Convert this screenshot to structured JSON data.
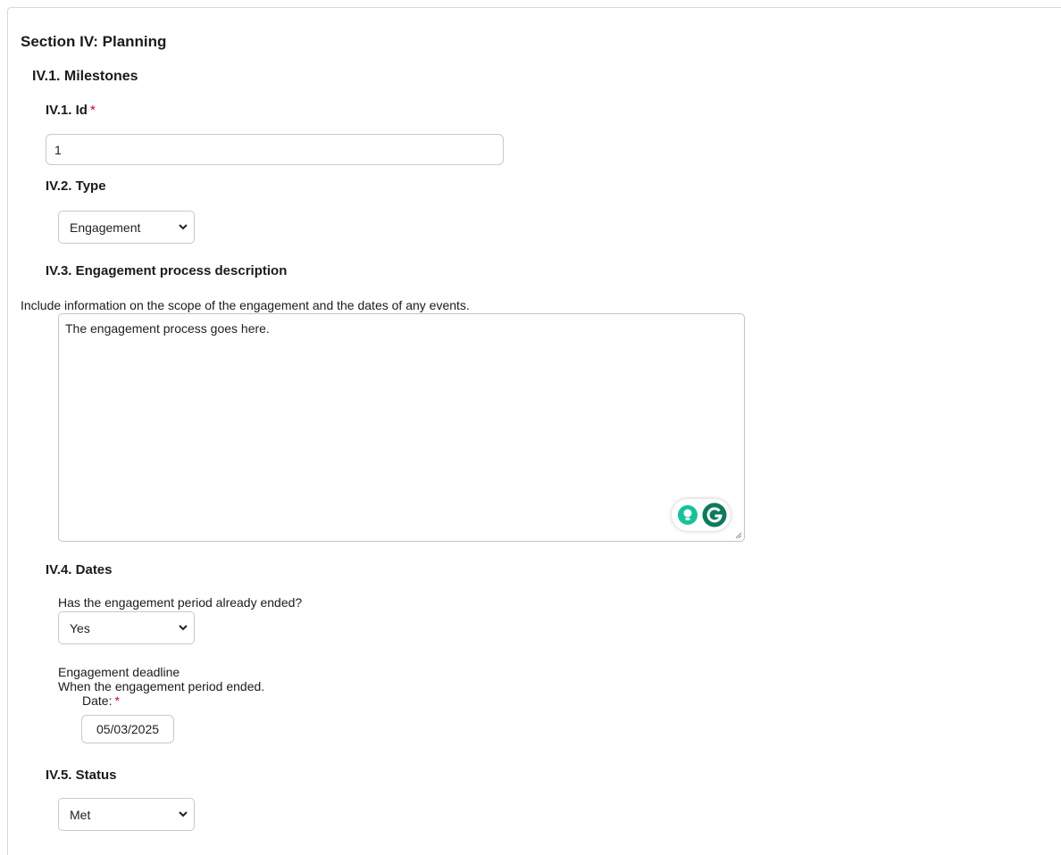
{
  "section": {
    "title": "Section IV: Planning",
    "subsection_title": "IV.1. Milestones"
  },
  "fields": {
    "id": {
      "label": "IV.1. Id",
      "required_marker": "*",
      "value": "1"
    },
    "type": {
      "label": "IV.2. Type",
      "selected": "Engagement"
    },
    "description": {
      "label": "IV.3. Engagement process description",
      "help": "Include information on the scope of the engagement and the dates of any events.",
      "value": "The engagement process goes here."
    },
    "dates": {
      "label": "IV.4. Dates",
      "question": "Has the engagement period already ended?",
      "ended_selected": "Yes",
      "deadline_label": "Engagement deadline",
      "deadline_help": "When the engagement period ended.",
      "date_label": "Date:",
      "required_marker": "*",
      "date_value": "05/03/2025"
    },
    "status": {
      "label": "IV.5. Status",
      "selected": "Met"
    }
  },
  "icons": {
    "select_arrow": "chevron-down-icon",
    "grammarly_suggest": "lightbulb-icon",
    "grammarly_logo": "grammarly-logo-icon",
    "resize": "resize-handle-icon"
  },
  "colors": {
    "required": "#d0021b",
    "grammarly_green": "#15c39a",
    "grammarly_dark": "#0c7a5b"
  }
}
